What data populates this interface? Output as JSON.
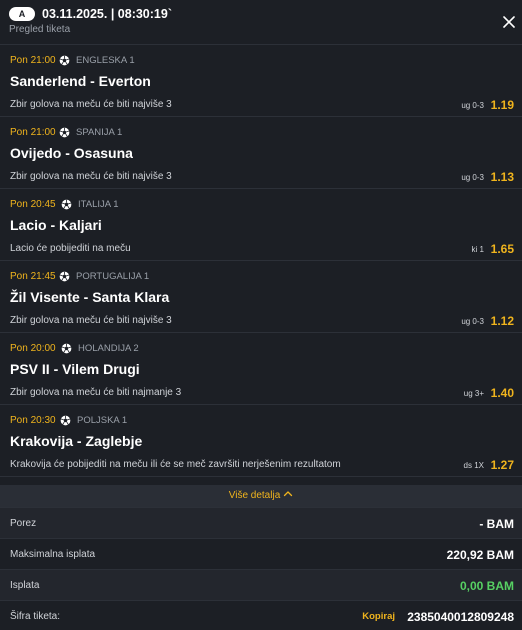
{
  "header": {
    "badge": "A",
    "datetime": "03.11.2025. | 08:30:19`",
    "subtitle": "Pregled tiketa",
    "close_icon": "close-icon"
  },
  "matches": [
    {
      "time": "Pon 21:00",
      "league": "ENGLESKA 1",
      "teams": "Sanderlend - Everton",
      "bet": "Zbir golova na meču će biti najviše 3",
      "code": "ug 0-3",
      "odd": "1.19",
      "icon": "soccer-ball-icon"
    },
    {
      "time": "Pon 21:00",
      "league": "SPANIJA 1",
      "teams": "Ovijedo - Osasuna",
      "bet": "Zbir golova na meču će biti najviše 3",
      "code": "ug 0-3",
      "odd": "1.13",
      "icon": "soccer-ball-icon"
    },
    {
      "time": "Pon 20:45",
      "league": "ITALIJA 1",
      "teams": "Lacio - Kaljari",
      "bet": "Lacio će pobijediti na meču",
      "code": "ki 1",
      "odd": "1.65",
      "icon": "soccer-ball-icon"
    },
    {
      "time": "Pon 21:45",
      "league": "PORTUGALIJA 1",
      "teams": "Žil Visente - Santa Klara",
      "bet": "Zbir golova na meču će biti najviše 3",
      "code": "ug 0-3",
      "odd": "1.12",
      "icon": "soccer-ball-icon"
    },
    {
      "time": "Pon 20:00",
      "league": "HOLANDIJA 2",
      "teams": "PSV II - Vilem Drugi",
      "bet": "Zbir golova na meču će biti najmanje 3",
      "code": "ug 3+",
      "odd": "1.40",
      "icon": "soccer-ball-icon"
    },
    {
      "time": "Pon 20:30",
      "league": "POLJSKA 1",
      "teams": "Krakovija - Zaglebje",
      "bet": "Krakovija će pobijediti na meču ili će se meč završiti nerješenim rezultatom",
      "code": "ds 1X",
      "odd": "1.27",
      "icon": "soccer-ball-icon"
    }
  ],
  "more": {
    "label": "Više detalja",
    "icon": "chevron-up-icon"
  },
  "summary": {
    "porez_label": "Porez",
    "porez_value": "- BAM",
    "max_label": "Maksimalna isplata",
    "max_value": "220,92 BAM",
    "isplata_label": "Isplata",
    "isplata_value": "0,00 BAM",
    "sifra_label": "Šifra tiketa:",
    "copy_label": "Kopiraj",
    "sifra_value": "2385040012809248"
  },
  "colors": {
    "background": "#1c1f25",
    "accent": "#f0b41d",
    "positive": "#57d163"
  }
}
